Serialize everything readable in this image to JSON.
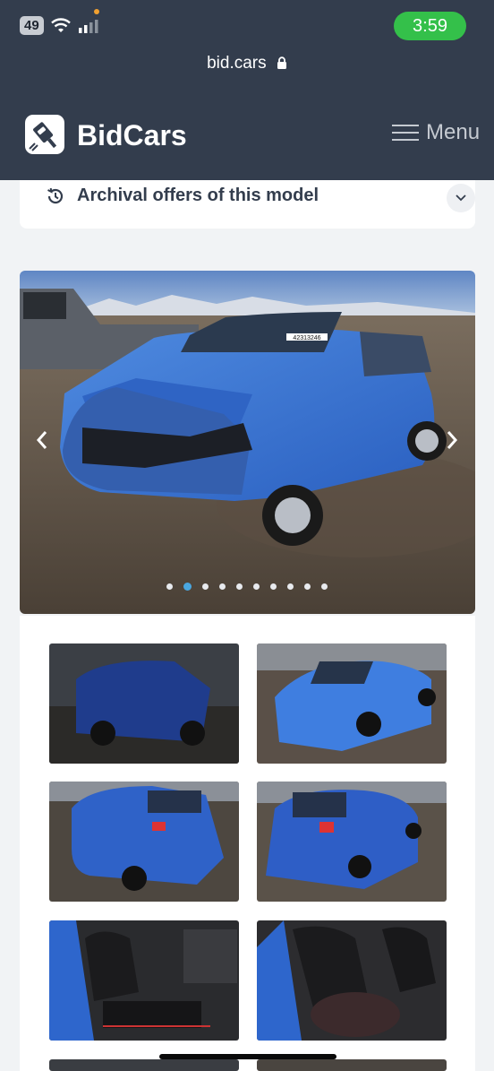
{
  "status_bar": {
    "battery": "49",
    "time": "3:59"
  },
  "browser": {
    "url": "bid.cars"
  },
  "header": {
    "brand": "BidCars",
    "menu_label": "Menu"
  },
  "archive": {
    "label": "Archival offers of this model"
  },
  "gallery": {
    "slide_count": 10,
    "active_slide": 1,
    "plate_text": "42313246"
  },
  "colors": {
    "header_bg": "#333d4d",
    "time_pill": "#34c04a",
    "car_blue": "#2f6fd0",
    "active_dot": "#4aa7e0"
  },
  "thumbnails": [
    {
      "name": "rear-left-dark"
    },
    {
      "name": "front-left"
    },
    {
      "name": "rear-left"
    },
    {
      "name": "rear-right"
    },
    {
      "name": "interior-driver-seat"
    },
    {
      "name": "interior-passenger-seat"
    }
  ]
}
